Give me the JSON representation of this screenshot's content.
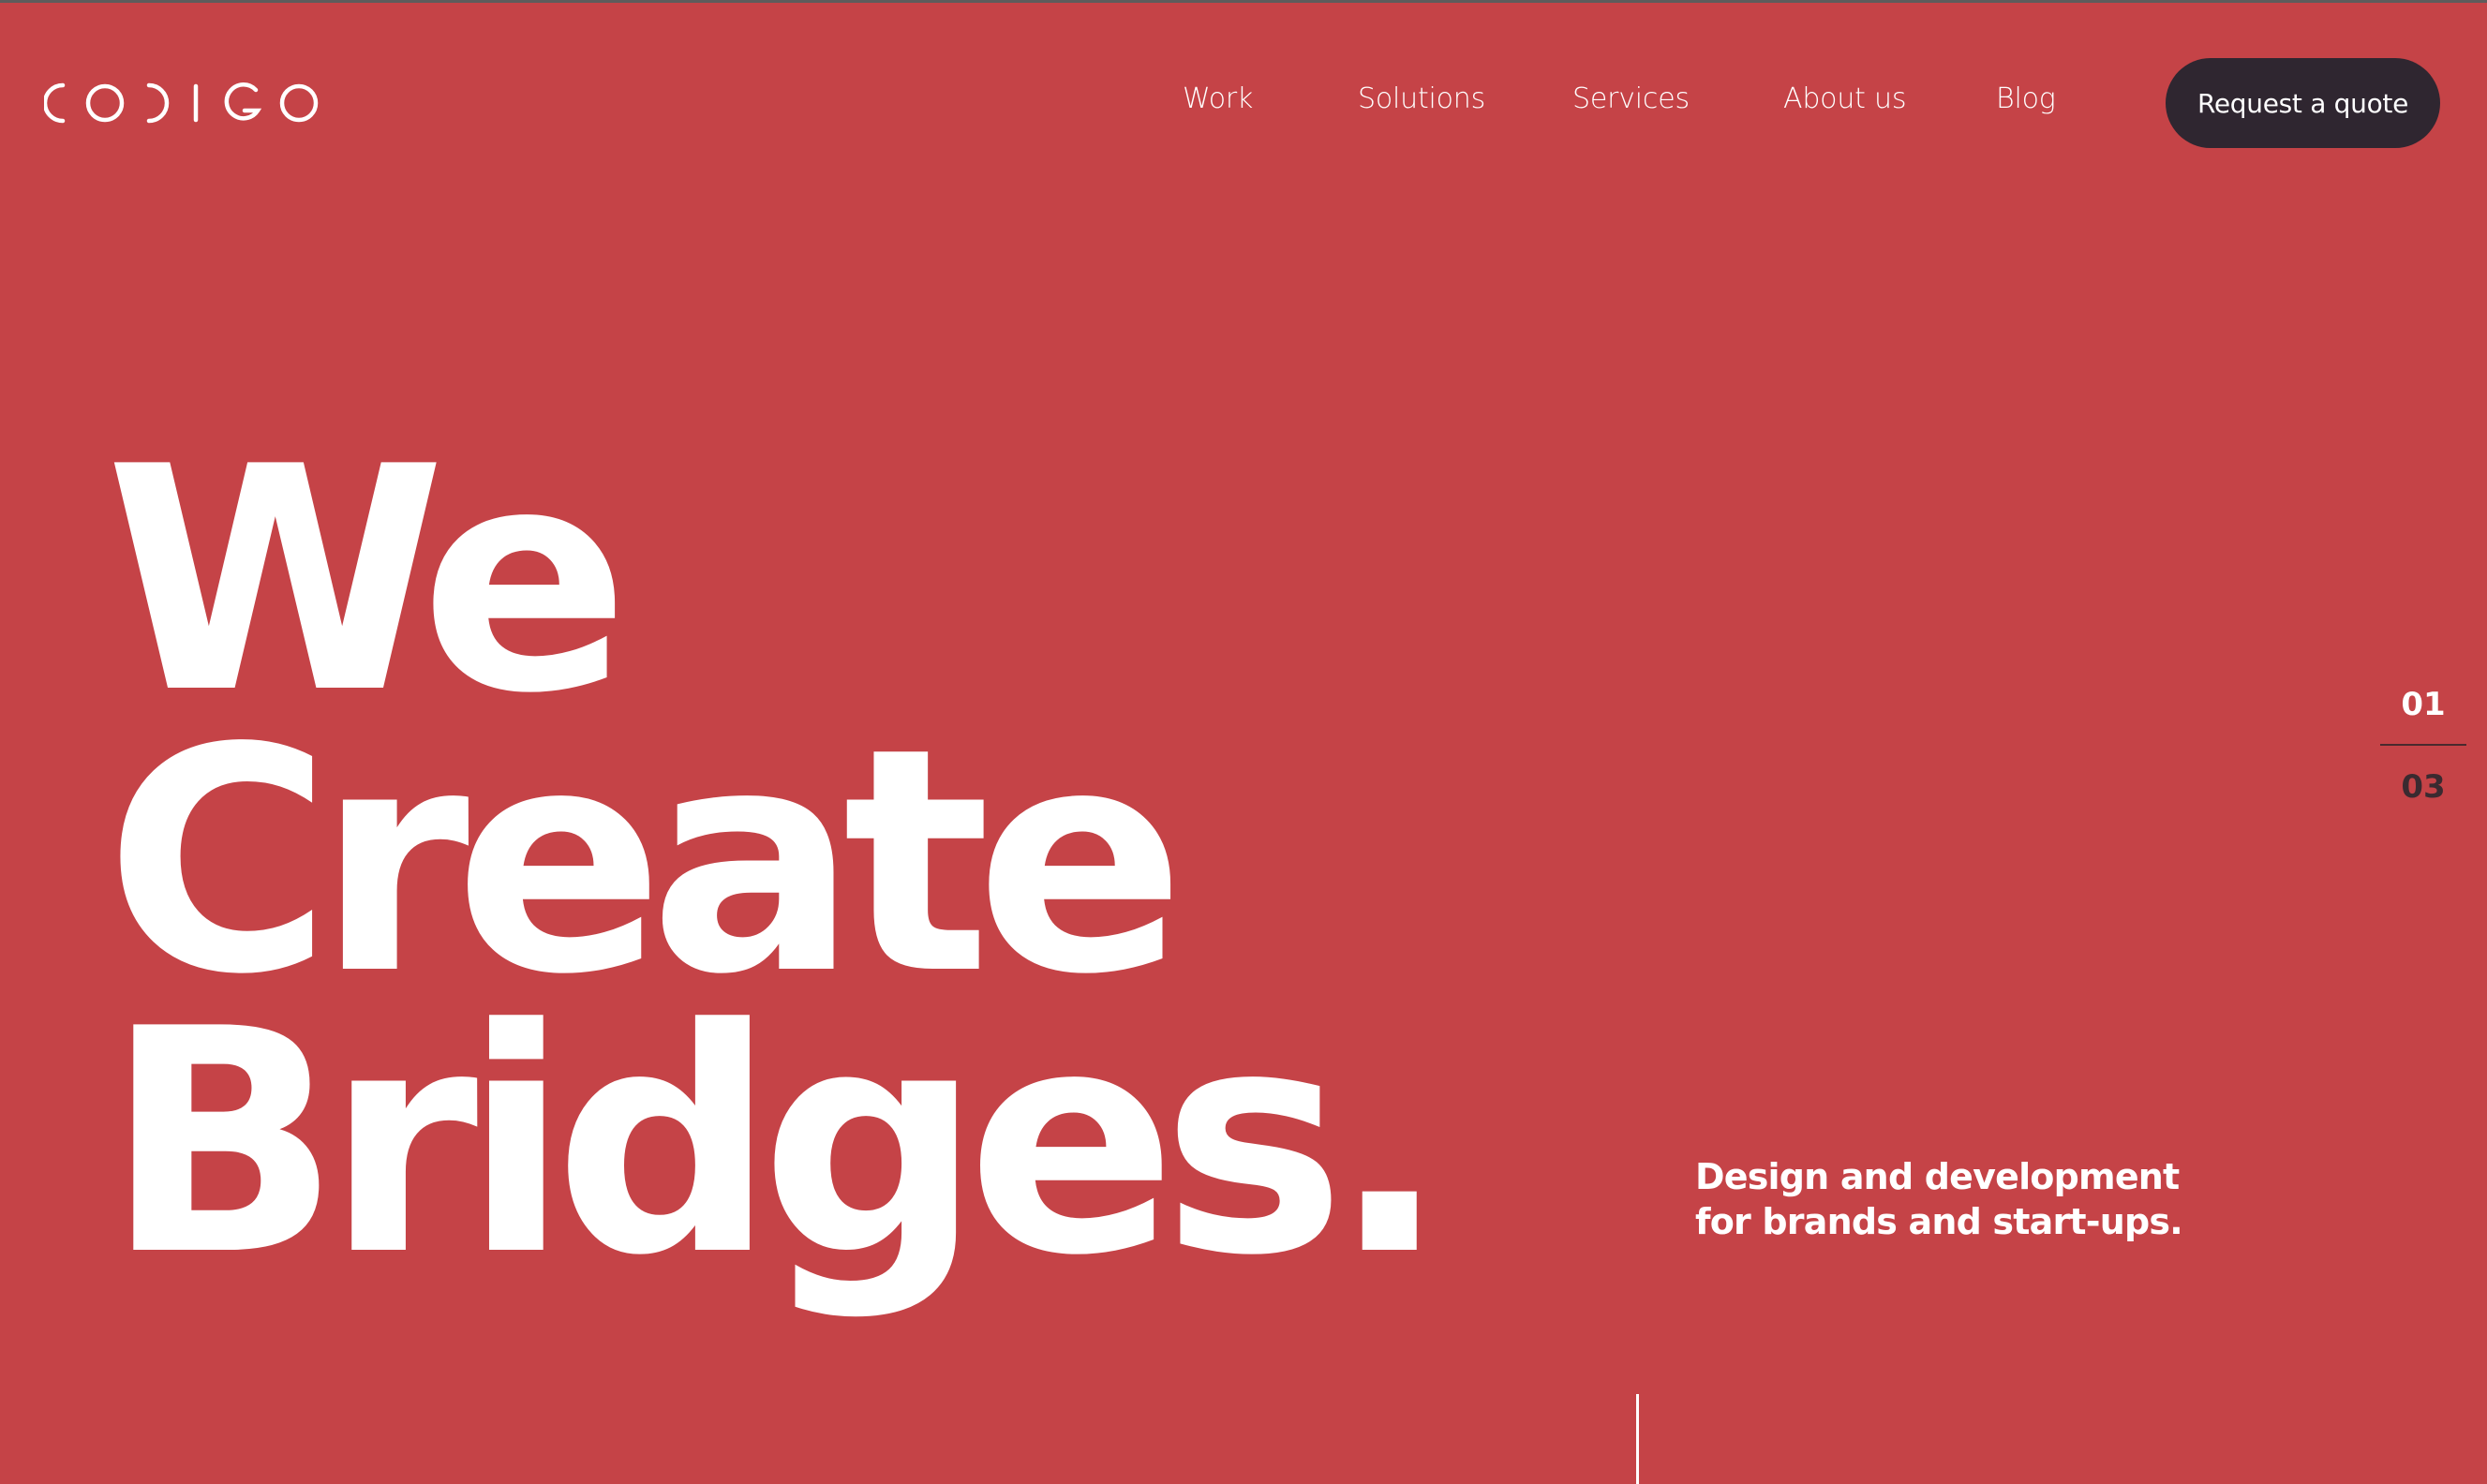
{
  "brand": {
    "logo_text": "CODIGO"
  },
  "nav": {
    "items": [
      {
        "label": "Work"
      },
      {
        "label": "Solutions"
      },
      {
        "label": "Services"
      },
      {
        "label": "About us"
      },
      {
        "label": "Blog"
      }
    ],
    "cta_label": "Request a quote"
  },
  "hero": {
    "headline_lines": [
      "We",
      "Create",
      "Bridges."
    ],
    "tagline": "Design and development for brands and start-ups."
  },
  "slider": {
    "current": "01",
    "total": "03"
  },
  "colors": {
    "background": "#c54347",
    "cta_background": "#2f2630",
    "text": "#ffffff"
  }
}
